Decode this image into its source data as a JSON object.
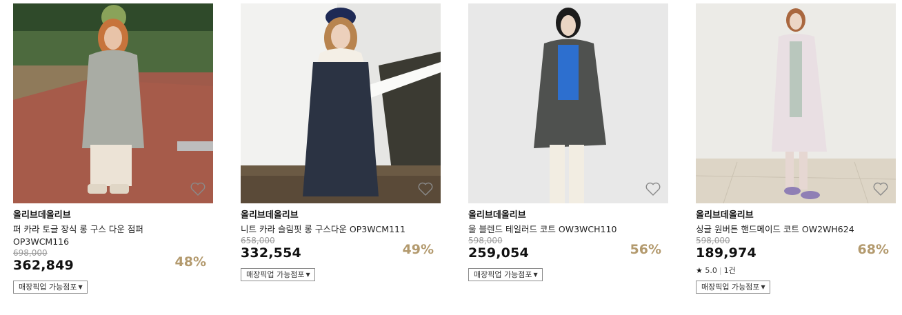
{
  "products": [
    {
      "brand": "올리브데올리브",
      "name": "퍼 카라 토글 장식 롱 구스 다운 점퍼 OP3WCM116",
      "original_price": "698,000",
      "price": "362,849",
      "discount": "48%",
      "pickup_label": "매장픽업 가능점포",
      "image_alt": "model in grey down coat with green beret on brick path"
    },
    {
      "brand": "올리브데올리브",
      "name": "니트 카라 슬림핏 롱 구스다운 OP3WCM111",
      "original_price": "658,000",
      "price": "332,554",
      "discount": "49%",
      "pickup_label": "매장픽업 가능점포",
      "image_alt": "model in navy long down coat with navy cap by white wall"
    },
    {
      "brand": "올리브데올리브",
      "name": "울 블렌드 테일러드 코트 OW3WCH110",
      "original_price": "598,000",
      "price": "259,054",
      "discount": "56%",
      "pickup_label": "매장픽업 가능점포",
      "image_alt": "model in charcoal tailored coat with blue knit"
    },
    {
      "brand": "올리브데올리브",
      "name": "싱글 원버튼 핸드메이드 코트 OW2WH624",
      "original_price": "598,000",
      "price": "189,974",
      "discount": "68%",
      "rating_score": "5.0",
      "review_count": "1건",
      "pickup_label": "매장픽업 가능점포",
      "image_alt": "model in light lavender handmade coat in bright room"
    }
  ],
  "icons": {
    "wish": "heart-outline-icon",
    "rating": "star-icon",
    "dropdown": "caret-down-icon"
  },
  "colors": {
    "discount": "#b39a6e",
    "text": "#111111",
    "strike": "#9a9a9a"
  }
}
